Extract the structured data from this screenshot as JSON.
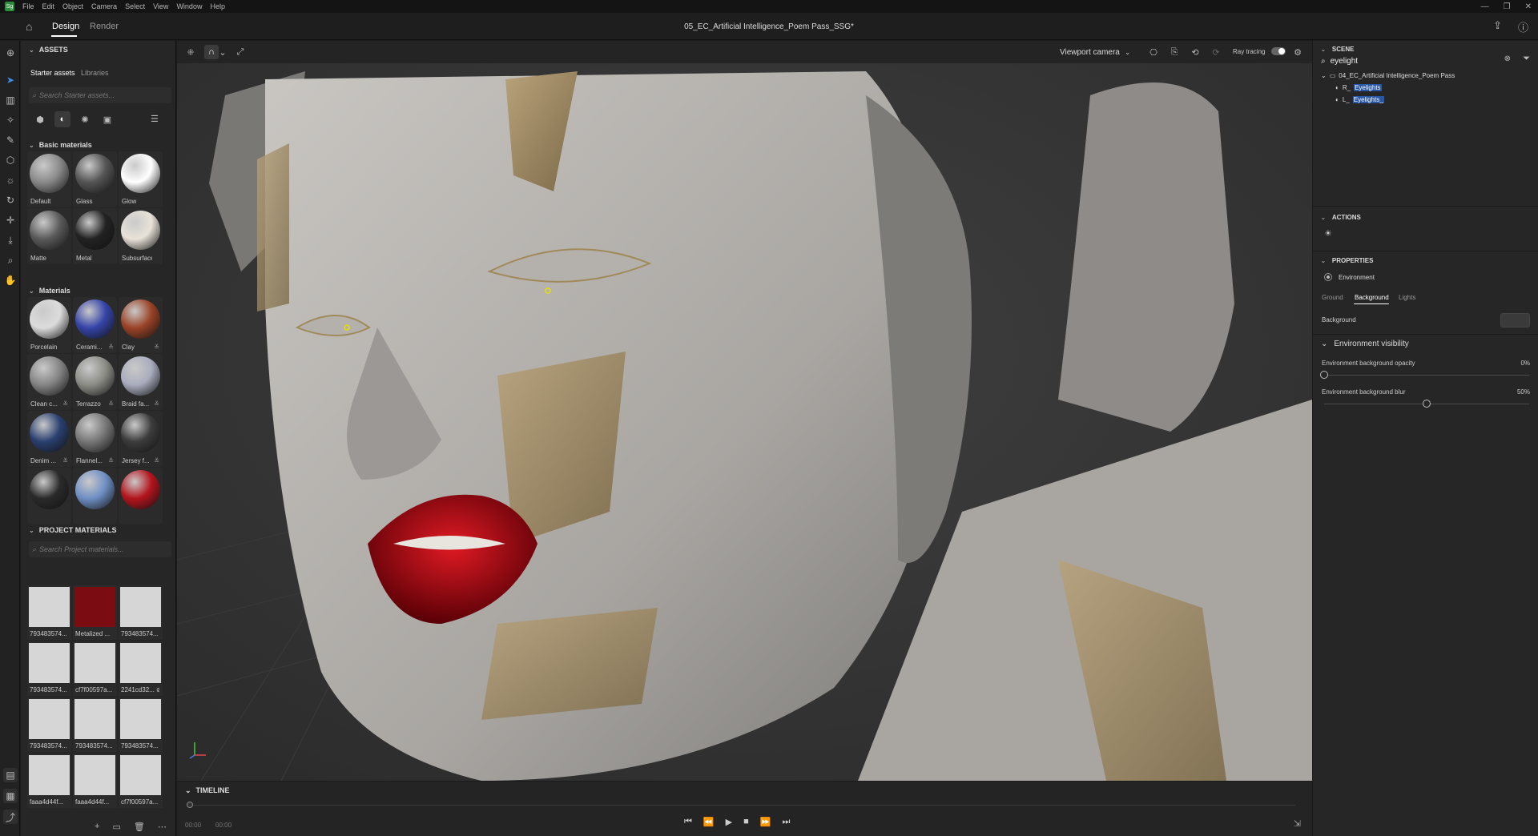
{
  "menu": {
    "logo": "Sg",
    "items": [
      "File",
      "Edit",
      "Object",
      "Camera",
      "Select",
      "View",
      "Window",
      "Help"
    ],
    "window_controls": [
      "—",
      "❐",
      "✕"
    ]
  },
  "header": {
    "tabs": [
      {
        "label": "Design",
        "active": true
      },
      {
        "label": "Render",
        "active": false
      }
    ],
    "title": "05_EC_Artificial Intelligence_Poem Pass_SSG*"
  },
  "assets": {
    "section": "ASSETS",
    "subtabs": [
      "Starter assets",
      "Libraries"
    ],
    "search_placeholder": "Search Starter assets...",
    "basic_materials": {
      "title": "Basic materials",
      "items": [
        {
          "label": "Default",
          "color": "#8a8a8a"
        },
        {
          "label": "Glass",
          "color": "#555"
        },
        {
          "label": "Glow",
          "color": "#fff"
        },
        {
          "label": "Matte",
          "color": "#5a5a5a"
        },
        {
          "label": "Metal",
          "color": "#222"
        },
        {
          "label": "Subsurface",
          "color": "#e8e2d8"
        }
      ]
    },
    "materials": {
      "title": "Materials",
      "items": [
        {
          "label": "Porcelain",
          "color": "#dcdcdc",
          "adj": false
        },
        {
          "label": "Cerami...",
          "color": "#3544a8",
          "adj": true
        },
        {
          "label": "Clay",
          "color": "#9a4326",
          "adj": true
        },
        {
          "label": "Clean c...",
          "color": "#858585",
          "adj": true
        },
        {
          "label": "Terrazzo",
          "color": "#8c8c86",
          "adj": true
        },
        {
          "label": "Braid fa...",
          "color": "#a9adbd",
          "adj": true
        },
        {
          "label": "Denim ...",
          "color": "#2a4070",
          "adj": true
        },
        {
          "label": "Flannel...",
          "color": "#777",
          "adj": true
        },
        {
          "label": "Jersey f...",
          "color": "#3c3c3c",
          "adj": true
        },
        {
          "label": "",
          "color": "#2a2a2a",
          "adj": false
        },
        {
          "label": "",
          "color": "#6f8fc4",
          "adj": false
        },
        {
          "label": "",
          "color": "#b3141c",
          "adj": false
        }
      ]
    },
    "project_materials": {
      "title": "PROJECT MATERIALS",
      "search_placeholder": "Search Project materials...",
      "items": [
        {
          "label": "793483574...",
          "color": "#d6d6d6"
        },
        {
          "label": "Metalized ...",
          "color": "#7a0c12"
        },
        {
          "label": "793483574...",
          "color": "#d6d6d6"
        },
        {
          "label": "793483574...",
          "color": "#d6d6d6"
        },
        {
          "label": "cf7f00597a...",
          "color": "#d6d6d6"
        },
        {
          "label": "2241cd32... ⊘",
          "color": "#d6d6d6"
        },
        {
          "label": "793483574...",
          "color": "#d6d6d6"
        },
        {
          "label": "793483574...",
          "color": "#d6d6d6"
        },
        {
          "label": "793483574...",
          "color": "#d6d6d6"
        },
        {
          "label": "faaa4d44f...",
          "color": "#d6d6d6"
        },
        {
          "label": "faaa4d44f...",
          "color": "#d6d6d6"
        },
        {
          "label": "cf7f00597a...",
          "color": "#d6d6d6"
        }
      ]
    }
  },
  "viewport": {
    "camera": "Viewport camera",
    "ray_tracing_label": "Ray tracing",
    "ray_tracing_on": true
  },
  "timeline": {
    "title": "TIMELINE",
    "start_time": "00:00",
    "end_time": "00:00"
  },
  "scene": {
    "title": "SCENE",
    "search_value": "eyelight",
    "tree": [
      {
        "label": "04_EC_Artificial Intelligence_Poem Pass",
        "level": 0
      },
      {
        "label": "R_Eyelights",
        "level": 1,
        "highlight": "Eyelights"
      },
      {
        "label": "L_Eyelights_",
        "level": 1,
        "highlight": "Eyelights_"
      }
    ]
  },
  "actions": {
    "title": "ACTIONS"
  },
  "properties": {
    "title": "PROPERTIES",
    "object": "Environment",
    "tabs": [
      {
        "label": "Ground",
        "active": false
      },
      {
        "label": "Background",
        "active": true
      },
      {
        "label": "Lights",
        "active": false
      }
    ],
    "background_label": "Background",
    "env_visibility_title": "Environment visibility",
    "opacity": {
      "label": "Environment background opacity",
      "value": "0%",
      "fraction": 0
    },
    "blur": {
      "label": "Environment background blur",
      "value": "50%",
      "fraction": 0.5
    }
  }
}
